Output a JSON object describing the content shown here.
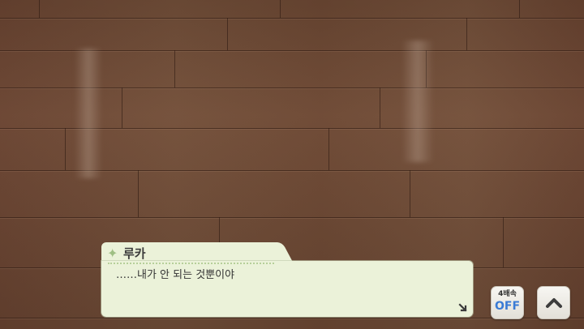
{
  "dialog": {
    "speaker": "루카",
    "text": "……내가 안 되는 것뿐이야"
  },
  "controls": {
    "speed_top": "4배속",
    "speed_bottom": "OFF"
  },
  "icons": {
    "speaker": "sparkle-icon",
    "advance": "advance-arrow-icon",
    "backlog": "chevron-up-icon"
  },
  "colors": {
    "dialog_bg": "#ebf2d9",
    "speed_off": "#3a7bd5",
    "floor": "#6e4a35"
  }
}
